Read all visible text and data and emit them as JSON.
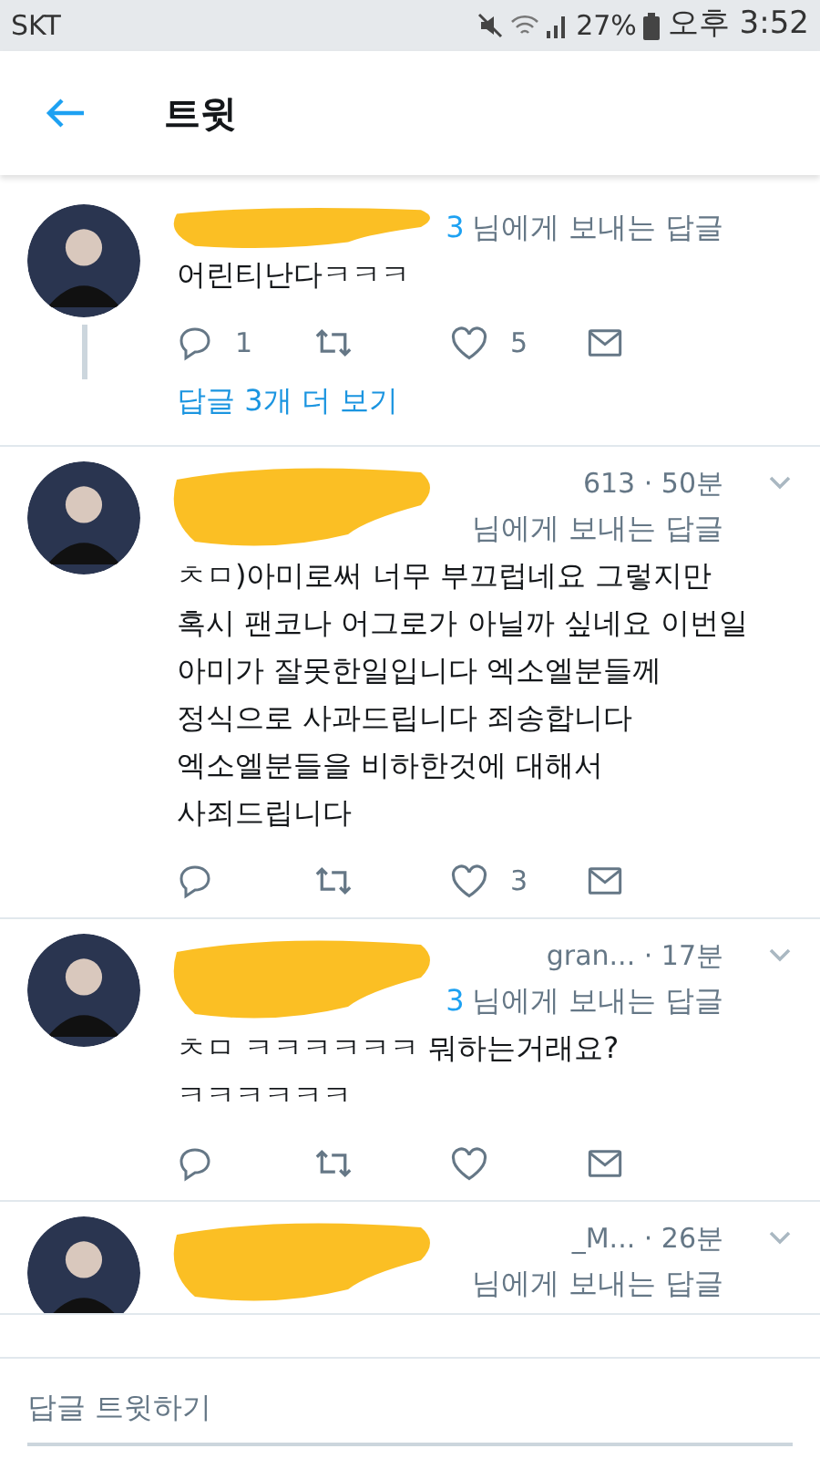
{
  "status_bar": {
    "carrier": "SKT",
    "battery": "27%",
    "time": "오후 3:52"
  },
  "header": {
    "title": "트윗"
  },
  "tweets": [
    {
      "redacted": true,
      "reply_handle": "3",
      "reply_to": "님에게 보내는 답글",
      "lines": [
        "어린티난다ㅋㅋㅋ"
      ],
      "reply_count": "1",
      "like_count": "5",
      "thread": true,
      "more_replies": "답글 3개 더 보기"
    },
    {
      "redacted": true,
      "meta": "613 · 50분",
      "reply_to": "님에게 보내는 답글",
      "lines": [
        "ㅊㅁ)아미로써 너무 부끄럽네요 그렇지만",
        "혹시 팬코나 어그로가 아닐까 싶네요 이번일",
        "아미가 잘못한일입니다 엑소엘분들께",
        "정식으로 사과드립니다 죄송합니다",
        "엑소엘분들을 비하한것에 대해서",
        "사죄드립니다"
      ],
      "like_count": "3"
    },
    {
      "redacted": true,
      "meta": "gran... · 17분",
      "reply_handle": "3",
      "reply_to": "님에게 보내는 답글",
      "lines": [
        "ㅊㅁ ㅋㅋㅋㅋㅋㅋ 뭐하는거래요?",
        "ㅋㅋㅋㅋㅋㅋ"
      ]
    },
    {
      "redacted": true,
      "meta": "_M... · 26분",
      "reply_to": "님에게 보내는 답글"
    }
  ],
  "compose": {
    "placeholder": "답글 트윗하기"
  }
}
